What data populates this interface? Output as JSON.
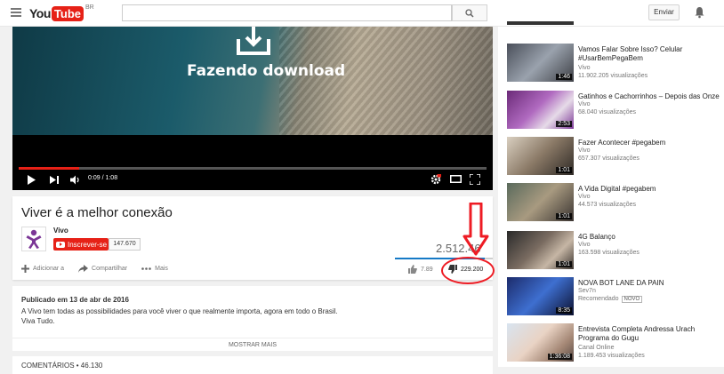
{
  "masthead": {
    "logo_you": "You",
    "logo_tube": "Tube",
    "logo_region": "BR",
    "search_placeholder": "",
    "upload_label": "Enviar"
  },
  "player": {
    "overlay_text": "Fazendo download",
    "time": "0:09 / 1:08",
    "progress_fraction": 0.13
  },
  "video": {
    "title": "Viver é a melhor conexão",
    "channel": "Vivo",
    "subscribe_label": "Inscrever-se",
    "subscriber_count": "147.670",
    "views": "2.512.46",
    "like_ratio": 0.92,
    "add_to_label": "Adicionar a",
    "share_label": "Compartilhar",
    "more_label": "Mais",
    "likes": "7.89",
    "dislikes": "229.200"
  },
  "description": {
    "published": "Publicado em 13 de abr de 2016",
    "line1": "A Vivo tem todas as possibilidades para você viver o que realmente importa, agora em todo o Brasil.",
    "line2": "Viva Tudo.",
    "show_more": "MOSTRAR MAIS"
  },
  "comments": {
    "label": "COMENTÁRIOS • 46.130"
  },
  "sidebar": {
    "items": [
      {
        "title": "Vamos Falar Sobre Isso? Celular",
        "title2": "#UsarBemPegaBem",
        "channel": "Vivo",
        "views": "11.902.205 visualizações",
        "duration": "1:46"
      },
      {
        "title": "Gatinhos e Cachorrinhos – Depois das Onze",
        "title2": "",
        "channel": "Vivo",
        "views": "68.040 visualizações",
        "duration": "2:53"
      },
      {
        "title": "Fazer Acontecer #pegabem",
        "title2": "",
        "channel": "Vivo",
        "views": "657.307 visualizações",
        "duration": "1:01"
      },
      {
        "title": "A Vida Digital #pegabem",
        "title2": "",
        "channel": "Vivo",
        "views": "44.573 visualizações",
        "duration": "1:01"
      },
      {
        "title": "4G Balanço",
        "title2": "",
        "channel": "Vivo",
        "views": "163.598 visualizações",
        "duration": "1:01"
      },
      {
        "title": "NOVA BOT LANE DA PAIN",
        "title2": "",
        "channel": "Sev7n",
        "views": "Recomendado",
        "badge": "NOVO",
        "duration": "8:35"
      },
      {
        "title": "Entrevista Completa Andressa Urach",
        "title2": "Programa do Gugu",
        "channel": "Canal Online",
        "views": "1.189.453 visualizações",
        "duration": "1:36:08"
      }
    ]
  }
}
